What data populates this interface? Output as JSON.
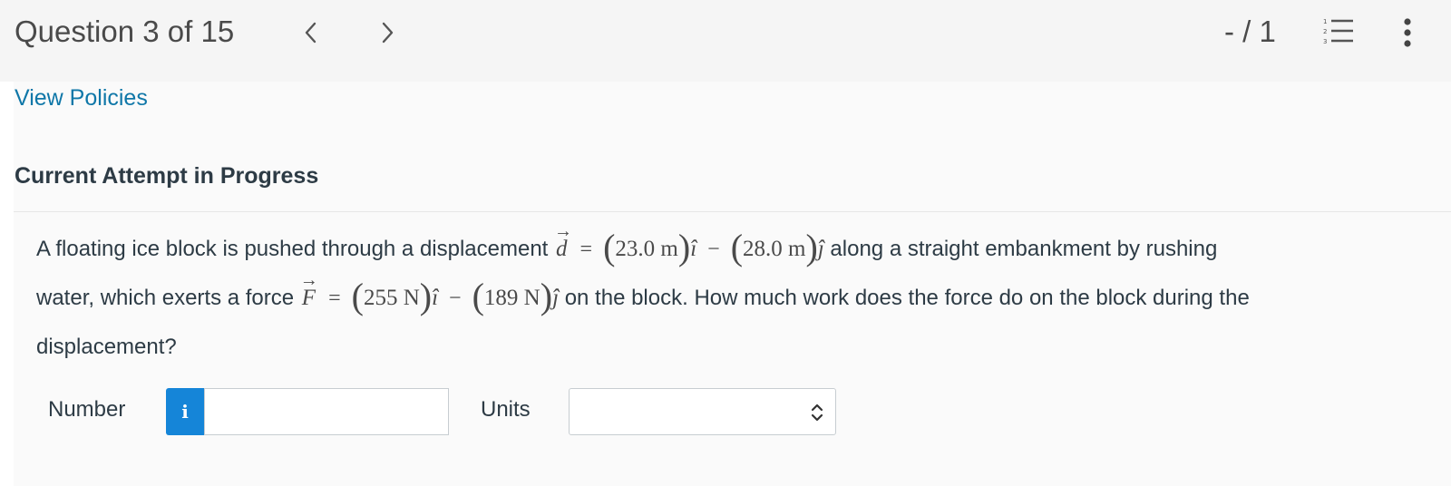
{
  "header": {
    "question_title": "Question 3 of 15",
    "score": "- / 1",
    "prev_icon": "chevron-left-icon",
    "next_icon": "chevron-right-icon",
    "list_icon": "numbered-list-icon",
    "more_icon": "more-vertical-icon"
  },
  "links": {
    "view_policies": "View Policies"
  },
  "attempt": {
    "heading": "Current Attempt in Progress"
  },
  "question": {
    "text_1": "A floating ice block is pushed through a displacement",
    "d_symbol": "d",
    "eq": "=",
    "d_x": "23.0 m",
    "i_hat": "î",
    "minus": "−",
    "d_y": "28.0 m",
    "j_hat": "ĵ",
    "text_2": "along a straight embankment by rushing",
    "text_3": "water, which exerts a force",
    "f_symbol": "F",
    "f_x": "255 N",
    "f_y": "189 N",
    "text_4": "on the block. How much work does the force do on the block during the",
    "text_5": "displacement?"
  },
  "answer": {
    "number_label": "Number",
    "info_label": "i",
    "number_value": "",
    "units_label": "Units",
    "units_selected": ""
  },
  "colors": {
    "link": "#0f77a8",
    "info_button": "#1585d8",
    "text": "#2d3b45"
  }
}
